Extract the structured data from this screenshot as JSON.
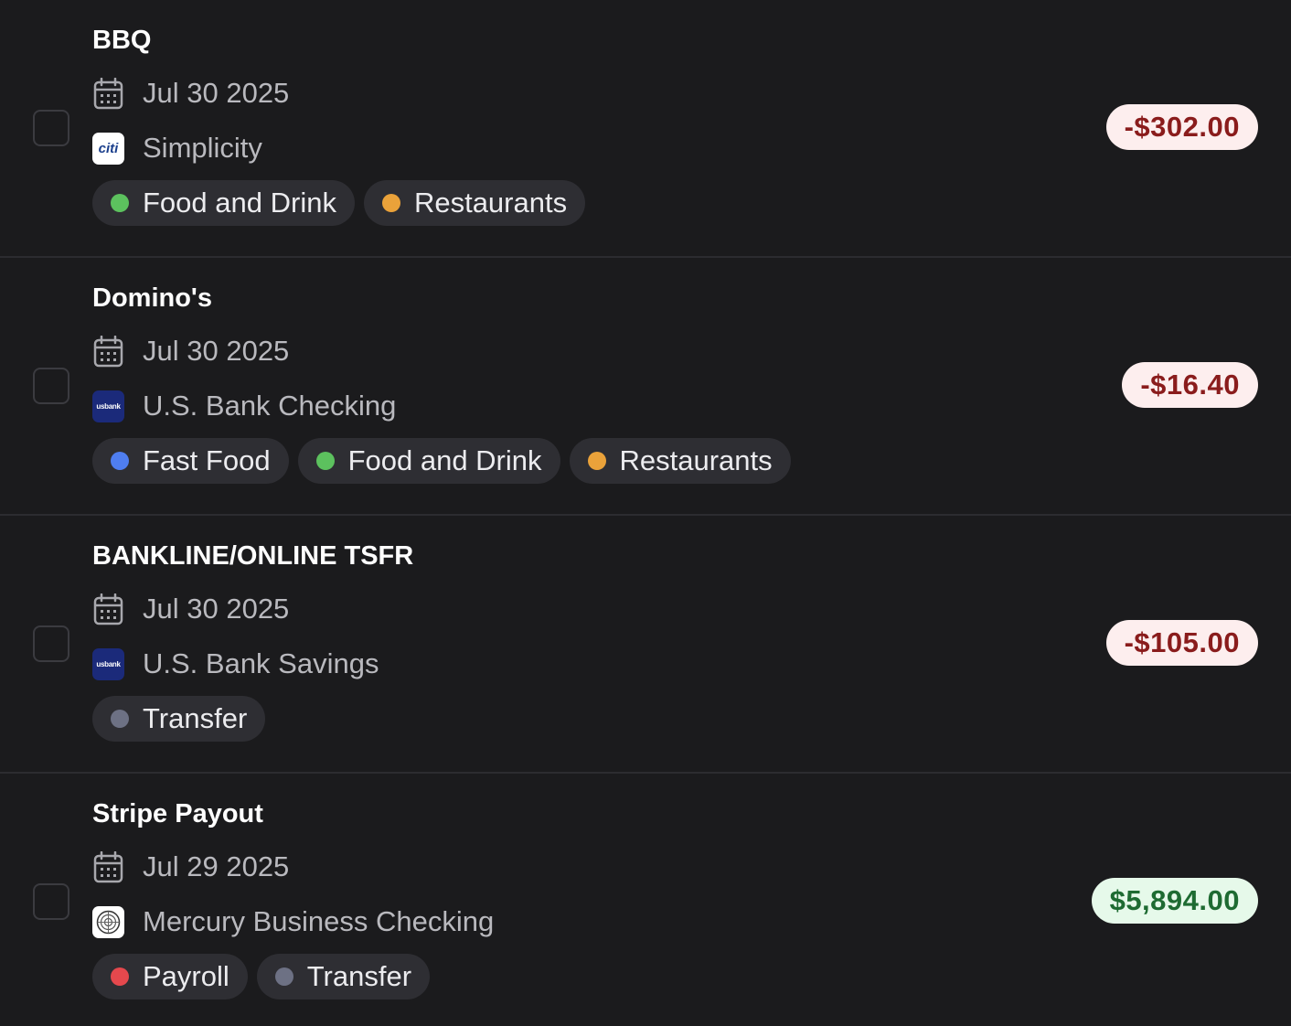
{
  "transactions": [
    {
      "title": "BBQ",
      "date": "Jul 30 2025",
      "account": "Simplicity",
      "account_logo": "citi-logo",
      "logo_text": "citi",
      "tags": [
        {
          "label": "Food and Drink",
          "color": "#5cc15e"
        },
        {
          "label": "Restaurants",
          "color": "#eaa23a"
        }
      ],
      "amount": "-$302.00",
      "amount_type": "negative"
    },
    {
      "title": "Domino's",
      "date": "Jul 30 2025",
      "account": "U.S. Bank Checking",
      "account_logo": "usbank-logo",
      "logo_text": "usbank",
      "tags": [
        {
          "label": "Fast Food",
          "color": "#4f7ef0"
        },
        {
          "label": "Food and Drink",
          "color": "#5cc15e"
        },
        {
          "label": "Restaurants",
          "color": "#eaa23a"
        }
      ],
      "amount": "-$16.40",
      "amount_type": "negative"
    },
    {
      "title": "BANKLINE/ONLINE TSFR",
      "date": "Jul 30 2025",
      "account": "U.S. Bank Savings",
      "account_logo": "usbank-logo",
      "logo_text": "usbank",
      "tags": [
        {
          "label": "Transfer",
          "color": "#6d7184"
        }
      ],
      "amount": "-$105.00",
      "amount_type": "negative"
    },
    {
      "title": "Stripe Payout",
      "date": "Jul 29 2025",
      "account": "Mercury Business Checking",
      "account_logo": "mercury-logo",
      "logo_text": "",
      "tags": [
        {
          "label": "Payroll",
          "color": "#e5484d"
        },
        {
          "label": "Transfer",
          "color": "#6d7184"
        }
      ],
      "amount": "$5,894.00",
      "amount_type": "positive"
    }
  ]
}
